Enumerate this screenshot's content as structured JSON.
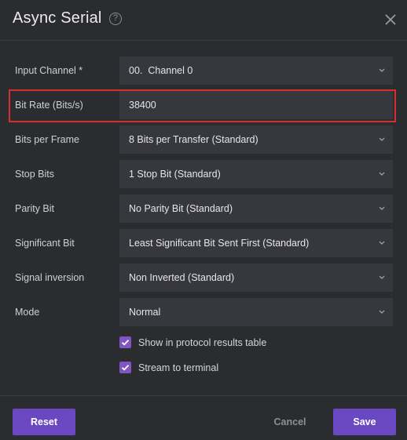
{
  "dialog": {
    "title": "Async Serial",
    "help_glyph": "?",
    "close_icon": "close-icon",
    "accent_color": "#6a48c2",
    "highlight_color": "#d32f2f"
  },
  "fields": {
    "input_channel": {
      "label": "Input Channel *",
      "prefix": "00.",
      "value": "Channel 0"
    },
    "bit_rate": {
      "label": "Bit Rate (Bits/s)",
      "value": "38400"
    },
    "bits_per_frame": {
      "label": "Bits per Frame",
      "value": "8 Bits per Transfer (Standard)"
    },
    "stop_bits": {
      "label": "Stop Bits",
      "value": "1 Stop Bit (Standard)"
    },
    "parity_bit": {
      "label": "Parity Bit",
      "value": "No Parity Bit (Standard)"
    },
    "significant_bit": {
      "label": "Significant Bit",
      "value": "Least Significant Bit Sent First (Standard)"
    },
    "signal_inversion": {
      "label": "Signal inversion",
      "value": "Non Inverted (Standard)"
    },
    "mode": {
      "label": "Mode",
      "value": "Normal"
    }
  },
  "checkboxes": {
    "show_in_table": {
      "label": "Show in protocol results table",
      "checked": true
    },
    "stream_to_terminal": {
      "label": "Stream to terminal",
      "checked": true
    }
  },
  "footer": {
    "reset_label": "Reset",
    "cancel_label": "Cancel",
    "save_label": "Save"
  }
}
